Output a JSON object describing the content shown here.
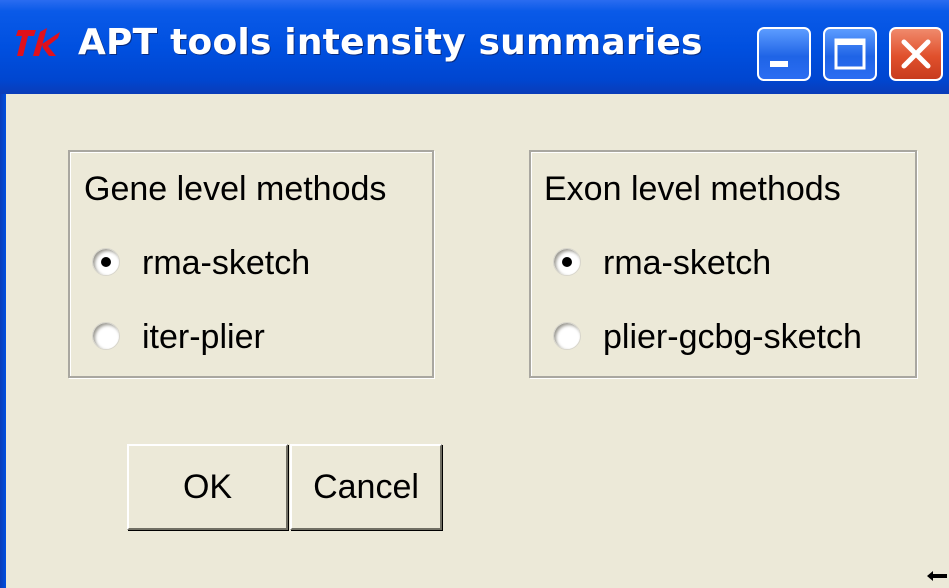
{
  "window": {
    "title": "APT tools intensity summaries",
    "controls": [
      "minimize",
      "maximize",
      "close"
    ]
  },
  "gene_group": {
    "label": "Gene level methods",
    "options": [
      {
        "label": "rma-sketch",
        "selected": true
      },
      {
        "label": "iter-plier",
        "selected": false
      }
    ]
  },
  "exon_group": {
    "label": "Exon level methods",
    "options": [
      {
        "label": "rma-sketch",
        "selected": true
      },
      {
        "label": "plier-gcbg-sketch",
        "selected": false
      }
    ]
  },
  "buttons": {
    "ok_label": "OK",
    "cancel_label": "Cancel"
  },
  "colors": {
    "titlebar": "#0050e0",
    "dialog_bg": "#ece9d8",
    "close_button": "#e0502c",
    "tk_icon": "#e0101c"
  },
  "icons": {
    "app": "tk-feather-icon",
    "minimize": "minimize-icon",
    "maximize": "maximize-icon",
    "close": "close-icon"
  }
}
